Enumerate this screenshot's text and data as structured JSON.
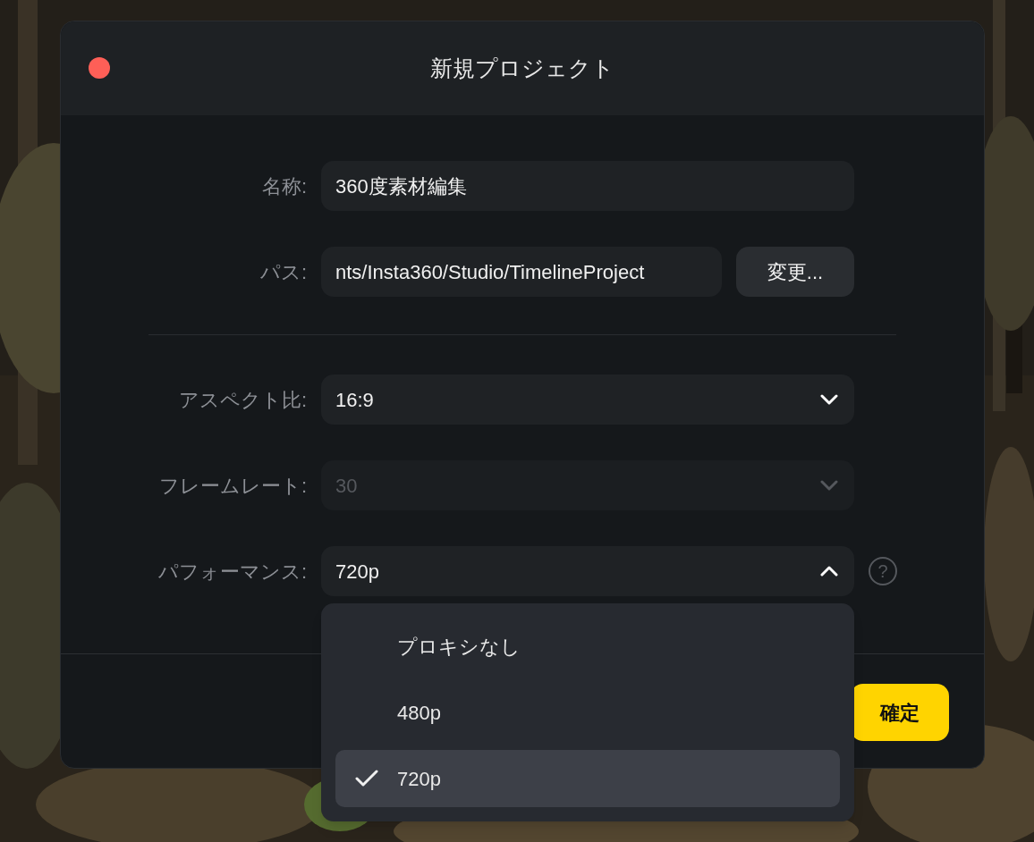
{
  "window": {
    "title": "新規プロジェクト",
    "close": true
  },
  "sections": [
    {
      "fields": [
        {
          "kind": "text",
          "label": "名称:",
          "value": "360度素材編集"
        },
        {
          "kind": "path",
          "label": "パス:",
          "value": "nts/Insta360/Studio/TimelineProject",
          "button": "変更..."
        }
      ]
    },
    {
      "fields": [
        {
          "kind": "select",
          "label": "アスペクト比:",
          "value": "16:9",
          "disabled": false,
          "expanded": false
        },
        {
          "kind": "select",
          "label": "フレームレート:",
          "value": "30",
          "disabled": true,
          "expanded": false
        },
        {
          "kind": "select",
          "label": "パフォーマンス:",
          "value": "720p",
          "disabled": false,
          "expanded": true,
          "help": "?",
          "options": [
            {
              "label": "プロキシなし",
              "selected": false
            },
            {
              "label": "480p",
              "selected": false
            },
            {
              "label": "720p",
              "selected": true
            }
          ]
        }
      ]
    }
  ],
  "confirm_button": "確定"
}
